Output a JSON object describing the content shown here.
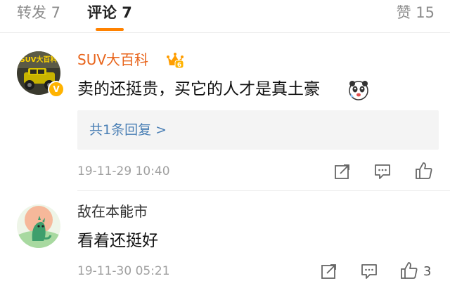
{
  "tabs": {
    "repost": "转发 7",
    "comments": "评论 7",
    "likes": "赞 15"
  },
  "colors": {
    "accent": "#ff8200",
    "vip_name": "#e8641b",
    "link": "#4a7fb5",
    "timestamp": "#a0a0a0"
  },
  "comments": [
    {
      "avatar_text": "SUV大百科",
      "username": "SUV大百科",
      "verified_badge": "V",
      "vip_badge": "6",
      "text": "卖的还挺贵，买它的人才是真土豪",
      "emoji_icon": "panda-face-icon",
      "reply_link": "共1条回复 >",
      "timestamp": "19-11-29 10:40",
      "actions": [
        "share-icon",
        "comment-icon",
        "like-icon"
      ]
    },
    {
      "username": "敌在本能市",
      "text": "看着还挺好",
      "timestamp": "19-11-30 05:21",
      "like_count": "3",
      "actions": [
        "share-icon",
        "comment-icon",
        "like-icon"
      ]
    }
  ]
}
